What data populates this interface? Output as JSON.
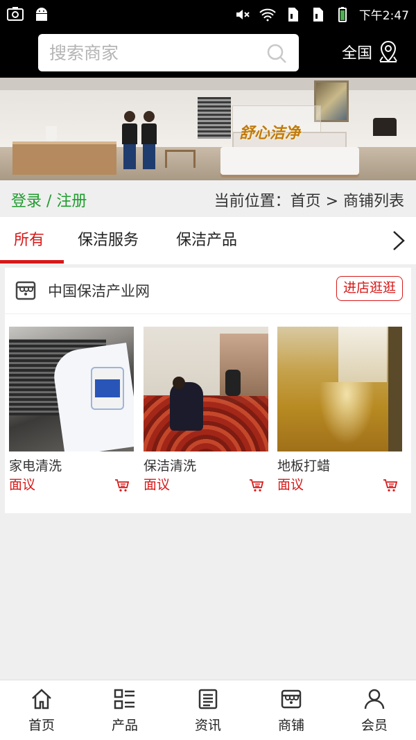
{
  "status_bar": {
    "time": "下午2:47",
    "icons": [
      "camera-icon",
      "android-icon",
      "mute-icon",
      "wifi-icon",
      "sim1-icon",
      "sim2-icon",
      "battery-icon"
    ]
  },
  "header": {
    "search_placeholder": "搜索商家",
    "region_label": "全国",
    "bg_color": "#000000"
  },
  "banner": {
    "slogan": "舒心洁净"
  },
  "breadcrumb": {
    "login": "登录",
    "separator": " / ",
    "register": "注册",
    "location": "当前位置：首页 > 商铺列表"
  },
  "tabs": [
    {
      "label": "所有",
      "active": true
    },
    {
      "label": "保洁服务",
      "active": false
    },
    {
      "label": "保洁产品",
      "active": false
    }
  ],
  "store": {
    "name": "中国保洁产业网",
    "visit_label": "进店逛逛",
    "products": [
      {
        "name": "家电清洗",
        "price": "面议"
      },
      {
        "name": "保洁清洗",
        "price": "面议"
      },
      {
        "name": "地板打蜡",
        "price": "面议"
      }
    ]
  },
  "bottom_nav": [
    {
      "label": "首页",
      "icon": "home-icon"
    },
    {
      "label": "产品",
      "icon": "grid-list-icon"
    },
    {
      "label": "资讯",
      "icon": "news-icon"
    },
    {
      "label": "商铺",
      "icon": "store-icon"
    },
    {
      "label": "会员",
      "icon": "user-icon"
    }
  ],
  "colors": {
    "accent": "#d71818",
    "login_green": "#1f9c2e",
    "page_bg": "#efefef"
  }
}
